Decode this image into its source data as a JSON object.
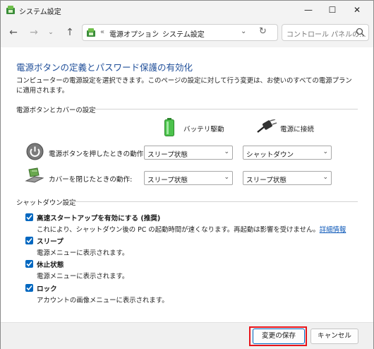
{
  "window": {
    "title": "システム設定",
    "controls": {
      "minimize": "—",
      "maximize": "☐",
      "close": "✕"
    }
  },
  "navigation": {
    "back": "←",
    "forward": "→",
    "recent": "⌄",
    "up": "↑",
    "address": {
      "prefix": "«",
      "crumbs": [
        "電源オプション",
        "システム設定"
      ],
      "separator": "›",
      "dropdown": "⌄",
      "refresh": "↻"
    },
    "search": {
      "placeholder": "コントロール パネルの..."
    }
  },
  "content": {
    "heading": "電源ボタンの定義とパスワード保護の有効化",
    "description": "コンピューターの電源設定を選択できます。このページの設定に対して行う変更は、お使いのすべての電源プランに適用されます。",
    "power_section": {
      "label": "電源ボタンとカバーの設定",
      "columns": {
        "battery": "バッテリ駆動",
        "plugged": "電源に接続"
      },
      "rows": [
        {
          "label": "電源ボタンを押したときの動作:",
          "icon": "power-button-icon",
          "battery": "スリープ状態",
          "plugged": "シャットダウン"
        },
        {
          "label": "カバーを閉じたときの動作:",
          "icon": "laptop-lid-icon",
          "battery": "スリープ状態",
          "plugged": "スリープ状態"
        }
      ]
    },
    "shutdown_section": {
      "label": "シャットダウン設定",
      "options": [
        {
          "title": "高速スタートアップを有効にする (推奨)",
          "desc": "これにより、シャットダウン後の PC の起動時間が速くなります。再起動は影響を受けません。",
          "link": "詳細情報",
          "checked": true
        },
        {
          "title": "スリープ",
          "desc": "電源メニューに表示されます。",
          "checked": true
        },
        {
          "title": "休止状態",
          "desc": "電源メニューに表示されます。",
          "checked": true
        },
        {
          "title": "ロック",
          "desc": "アカウントの画像メニューに表示されます。",
          "checked": true
        }
      ]
    }
  },
  "footer": {
    "save": "変更の保存",
    "cancel": "キャンセル"
  },
  "colors": {
    "heading": "#1f4e99",
    "checkbox": "#0067c0",
    "highlight": "#e8141b",
    "link": "#0b57b8"
  }
}
